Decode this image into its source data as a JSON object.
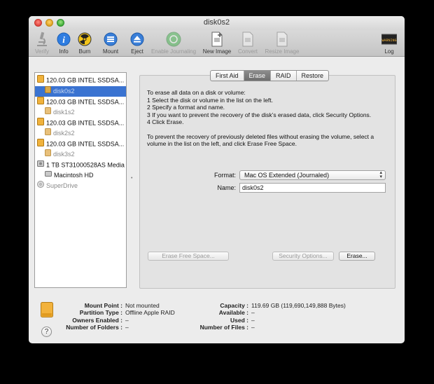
{
  "window": {
    "title": "disk0s2"
  },
  "toolbar": {
    "items": [
      {
        "label": "Verify",
        "icon": "microscope-icon",
        "enabled": false
      },
      {
        "label": "Info",
        "icon": "info-icon",
        "enabled": true
      },
      {
        "label": "Burn",
        "icon": "burn-icon",
        "enabled": true
      },
      {
        "label": "Mount",
        "icon": "mount-icon",
        "enabled": true
      },
      {
        "label": "Eject",
        "icon": "eject-icon",
        "enabled": true
      },
      {
        "label": "Enable Journaling",
        "icon": "journaling-icon",
        "enabled": false
      },
      {
        "label": "New Image",
        "icon": "new-image-icon",
        "enabled": true
      },
      {
        "label": "Convert",
        "icon": "convert-icon",
        "enabled": false
      },
      {
        "label": "Resize Image",
        "icon": "resize-image-icon",
        "enabled": false
      }
    ],
    "log_label": "Log",
    "log_icon_text": "WARNING"
  },
  "sidebar": {
    "items": [
      {
        "label": "120.03 GB INTEL SSDSA...",
        "kind": "disk"
      },
      {
        "label": "disk0s2",
        "kind": "volume",
        "selected": true
      },
      {
        "label": "120.03 GB INTEL SSDSA...",
        "kind": "disk"
      },
      {
        "label": "disk1s2",
        "kind": "volume"
      },
      {
        "label": "120.03 GB INTEL SSDSA...",
        "kind": "disk"
      },
      {
        "label": "disk2s2",
        "kind": "volume"
      },
      {
        "label": "120.03 GB INTEL SSDSA...",
        "kind": "disk"
      },
      {
        "label": "disk3s2",
        "kind": "volume"
      },
      {
        "label": "1 TB ST31000528AS Media",
        "kind": "hdd"
      },
      {
        "label": "Macintosh HD",
        "kind": "hd-volume"
      },
      {
        "label": "SuperDrive",
        "kind": "superdrive"
      }
    ]
  },
  "tabs": [
    {
      "label": "First Aid",
      "active": false
    },
    {
      "label": "Erase",
      "active": true
    },
    {
      "label": "RAID",
      "active": false
    },
    {
      "label": "Restore",
      "active": false
    }
  ],
  "erase": {
    "intro": "To erase all data on a disk or volume:",
    "steps": [
      "1 Select the disk or volume in the list on the left.",
      "2 Specify a format and name.",
      "3 If you want to prevent the recovery of the disk’s erased data, click Security Options.",
      "4 Click Erase."
    ],
    "note": "To prevent the recovery of previously deleted files without erasing the volume, select a volume in the list on the left, and click Erase Free Space.",
    "format_label": "Format:",
    "format_value": "Mac OS Extended (Journaled)",
    "name_label": "Name:",
    "name_value": "disk0s2",
    "erase_free_space_label": "Erase Free Space...",
    "security_options_label": "Security Options...",
    "erase_label": "Erase..."
  },
  "info": {
    "mount_point_label": "Mount Point :",
    "mount_point_value": "Not mounted",
    "partition_type_label": "Partition Type :",
    "partition_type_value": "Offline Apple RAID",
    "owners_enabled_label": "Owners Enabled :",
    "owners_enabled_value": "–",
    "folders_label": "Number of Folders :",
    "folders_value": "–",
    "capacity_label": "Capacity :",
    "capacity_value": "119.69 GB (119,690,149,888 Bytes)",
    "available_label": "Available :",
    "available_value": "–",
    "used_label": "Used :",
    "used_value": "–",
    "files_label": "Number of Files :",
    "files_value": "–",
    "help_label": "?"
  },
  "colors": {
    "selection": "#3a73d1",
    "disk_orange": "#f0b23c",
    "window_bg": "#ececec"
  }
}
